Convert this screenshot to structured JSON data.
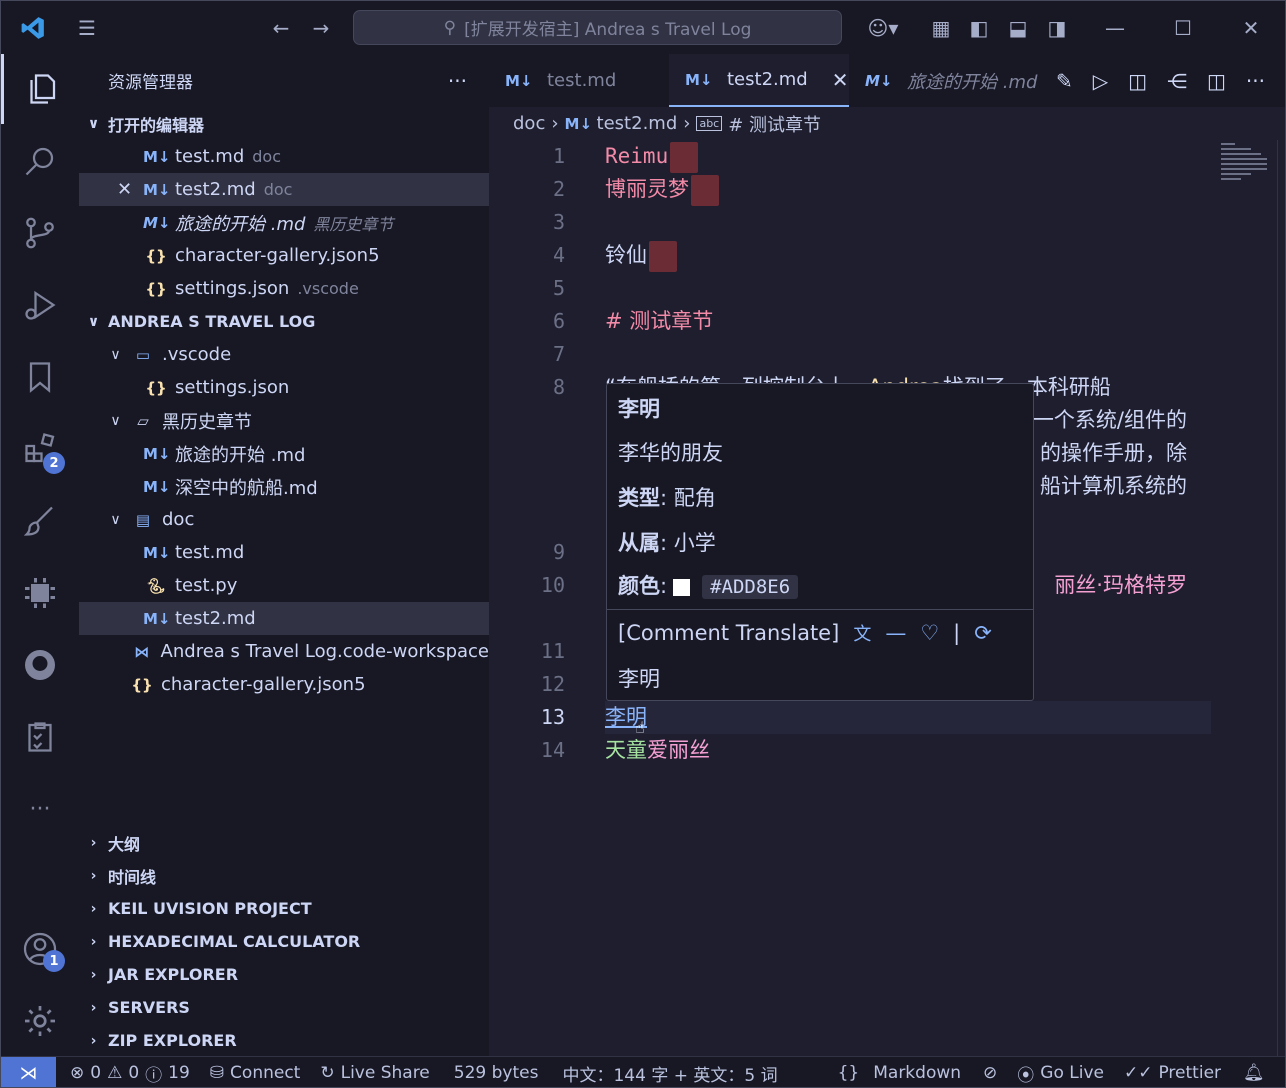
{
  "window": {
    "search_text": "[扩展开发宿主] Andrea s Travel Log"
  },
  "activity": {
    "extensions_badge": "2",
    "account_badge": "1",
    "more": "···"
  },
  "sidebar": {
    "title": "资源管理器",
    "more": "···",
    "open_editors": {
      "header": "打开的编辑器",
      "items": [
        {
          "name": "test.md",
          "desc": "doc",
          "icon": "md"
        },
        {
          "name": "test2.md",
          "desc": "doc",
          "icon": "md"
        },
        {
          "name": "旅途的开始 .md",
          "desc": "黑历史章节",
          "icon": "md"
        },
        {
          "name": "character-gallery.json5",
          "desc": "",
          "icon": "json"
        },
        {
          "name": "settings.json",
          "desc": ".vscode",
          "icon": "json"
        }
      ]
    },
    "workspace": {
      "header": "ANDREA S TRAVEL LOG",
      "items": [
        {
          "name": ".vscode",
          "type": "folder"
        },
        {
          "name": "settings.json",
          "type": "json"
        },
        {
          "name": "黑历史章节",
          "type": "folder"
        },
        {
          "name": "旅途的开始 .md",
          "type": "md"
        },
        {
          "name": "深空中的航船.md",
          "type": "md"
        },
        {
          "name": "doc",
          "type": "folder"
        },
        {
          "name": "test.md",
          "type": "md"
        },
        {
          "name": "test.py",
          "type": "py"
        },
        {
          "name": "test2.md",
          "type": "md"
        },
        {
          "name": "Andrea s Travel Log.code-workspace",
          "type": "workspace"
        },
        {
          "name": "character-gallery.json5",
          "type": "json"
        }
      ]
    },
    "panels": [
      "大纲",
      "时间线",
      "KEIL UVISION PROJECT",
      "HEXADECIMAL CALCULATOR",
      "JAR EXPLORER",
      "SERVERS",
      "ZIP EXPLORER"
    ]
  },
  "editor": {
    "tabs": [
      {
        "label": "test.md"
      },
      {
        "label": "test2.md"
      },
      {
        "label": "旅途的开始 .md"
      }
    ],
    "breadcrumb": {
      "folder": "doc",
      "file": "test2.md",
      "symbol": "# 测试章节"
    },
    "lines": {
      "l1": "Reimu",
      "l2": "博丽灵梦",
      "l4": "铃仙",
      "l6": "# 测试章节",
      "l8a": "“在舰桥的第一列控制台上，",
      "l8b": "Andrea",
      "l8c": "找到了一本科研船",
      "l8d": "一个系统/组件的",
      "l8e": "的操作手册，除",
      "l8f": "船计算机系统的",
      "l10": "丽丝·玛格特罗",
      "l13": "李明",
      "l14a": "天童",
      "l14b": "爱丽丝"
    },
    "line_numbers": [
      "1",
      "2",
      "3",
      "4",
      "5",
      "6",
      "7",
      "8",
      "9",
      "10",
      "11",
      "12",
      "13",
      "14"
    ]
  },
  "hover": {
    "name": "李明",
    "desc": "李华的朋友",
    "type_label": "类型",
    "type_value": ": 配角",
    "from_label": "从属",
    "from_value": ": 小学",
    "color_label": "颜色",
    "color_value": "#ADD8E6",
    "translate_label": "[Comment Translate]",
    "translate_result": "李明",
    "sep": "|"
  },
  "status": {
    "errors": "0",
    "warnings": "0",
    "infos": "19",
    "connect": "Connect",
    "live_share": "Live Share",
    "size": "529 bytes",
    "word_count": "中文：144 字 + 英文：5 词",
    "language": "Markdown",
    "go_live": "Go Live",
    "prettier": "Prettier"
  },
  "colors": {
    "accent": "#89b4fa",
    "character_red": "#f38ba8",
    "character_pink": "#f5a0d3",
    "character_green": "#a6e3a1",
    "swatch": "#ADD8E6"
  }
}
